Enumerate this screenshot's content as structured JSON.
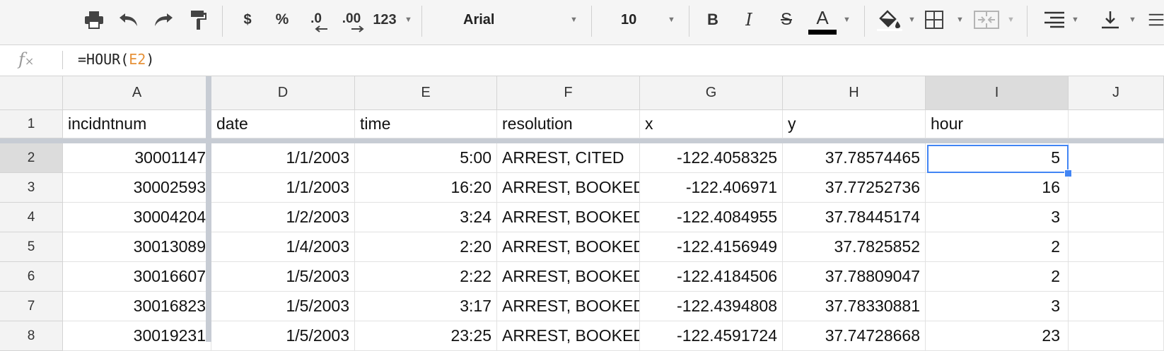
{
  "toolbar": {
    "currency": "$",
    "percent": "%",
    "decrease_decimals": ".0",
    "increase_decimals": ".00",
    "more_formats": "123",
    "font_family": "Arial",
    "font_size": "10",
    "bold": "B",
    "italic": "I",
    "strikethrough": "S",
    "text_color": "A"
  },
  "formula_bar": {
    "fx_label": "fx",
    "formula_prefix": "=HOUR(",
    "formula_ref": "E2",
    "formula_suffix": ")"
  },
  "columns": [
    "A",
    "D",
    "E",
    "F",
    "G",
    "H",
    "I",
    "J"
  ],
  "selected_column": "I",
  "header_row": {
    "row": "1",
    "cells": [
      "incidntnum",
      "date",
      "time",
      "resolution",
      "x",
      "y",
      "hour",
      ""
    ]
  },
  "rows": [
    {
      "row": "2",
      "cells": [
        "30001147",
        "1/1/2003",
        "5:00",
        "ARREST, CITED",
        "-122.4058325",
        "37.78574465",
        "5",
        ""
      ]
    },
    {
      "row": "3",
      "cells": [
        "30002593",
        "1/1/2003",
        "16:20",
        "ARREST, BOOKED",
        "-122.406971",
        "37.77252736",
        "16",
        ""
      ]
    },
    {
      "row": "4",
      "cells": [
        "30004204",
        "1/2/2003",
        "3:24",
        "ARREST, BOOKED",
        "-122.4084955",
        "37.78445174",
        "3",
        ""
      ]
    },
    {
      "row": "5",
      "cells": [
        "30013089",
        "1/4/2003",
        "2:20",
        "ARREST, BOOKED",
        "-122.4156949",
        "37.7825852",
        "2",
        ""
      ]
    },
    {
      "row": "6",
      "cells": [
        "30016607",
        "1/5/2003",
        "2:22",
        "ARREST, BOOKED",
        "-122.4184506",
        "37.78809047",
        "2",
        ""
      ]
    },
    {
      "row": "7",
      "cells": [
        "30016823",
        "1/5/2003",
        "3:17",
        "ARREST, BOOKED",
        "-122.4394808",
        "37.78330881",
        "3",
        ""
      ]
    },
    {
      "row": "8",
      "cells": [
        "30019231",
        "1/5/2003",
        "23:25",
        "ARREST, BOOKED",
        "-122.4591724",
        "37.74728668",
        "23",
        ""
      ]
    }
  ],
  "colors": {
    "selection": "#4285f4",
    "formula_ref": "#e69138",
    "header_bg": "#f3f3f3"
  }
}
